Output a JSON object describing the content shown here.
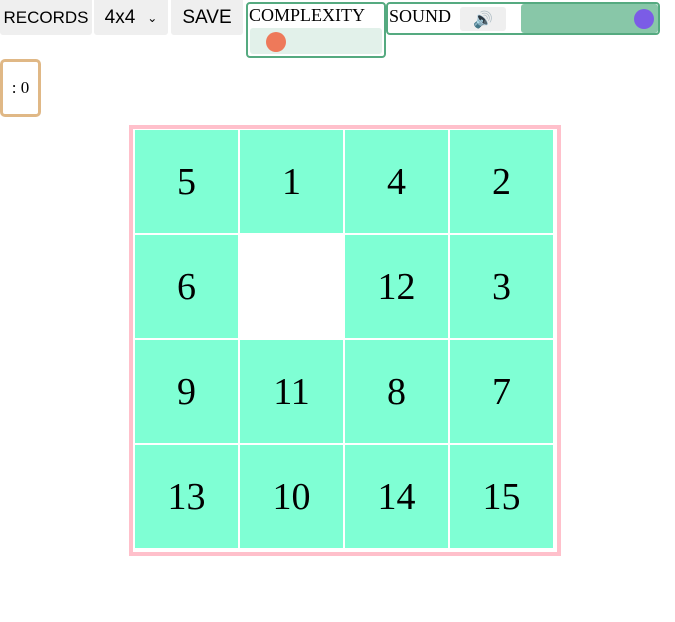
{
  "toolbar": {
    "records_label": "RECORDS",
    "size_select": "4x4",
    "save_label": "SAVE",
    "complexity_label": "COMPLEXITY",
    "complexity_level": 0.1,
    "sound_label": "SOUND",
    "sound_icon": "speaker-icon",
    "sound_level": 1.0
  },
  "moves_text": ": 0",
  "board": {
    "tiles": [
      "5",
      "1",
      "4",
      "2",
      "6",
      "",
      "12",
      "3",
      "9",
      "11",
      "8",
      "7",
      "13",
      "10",
      "14",
      "15"
    ]
  },
  "colors": {
    "tile": "#7fffd4",
    "board_border": "#ffc0cb",
    "accent": "#55aa80",
    "complexity_thumb": "#ee795a",
    "sound_thumb": "#7b5ce6"
  }
}
